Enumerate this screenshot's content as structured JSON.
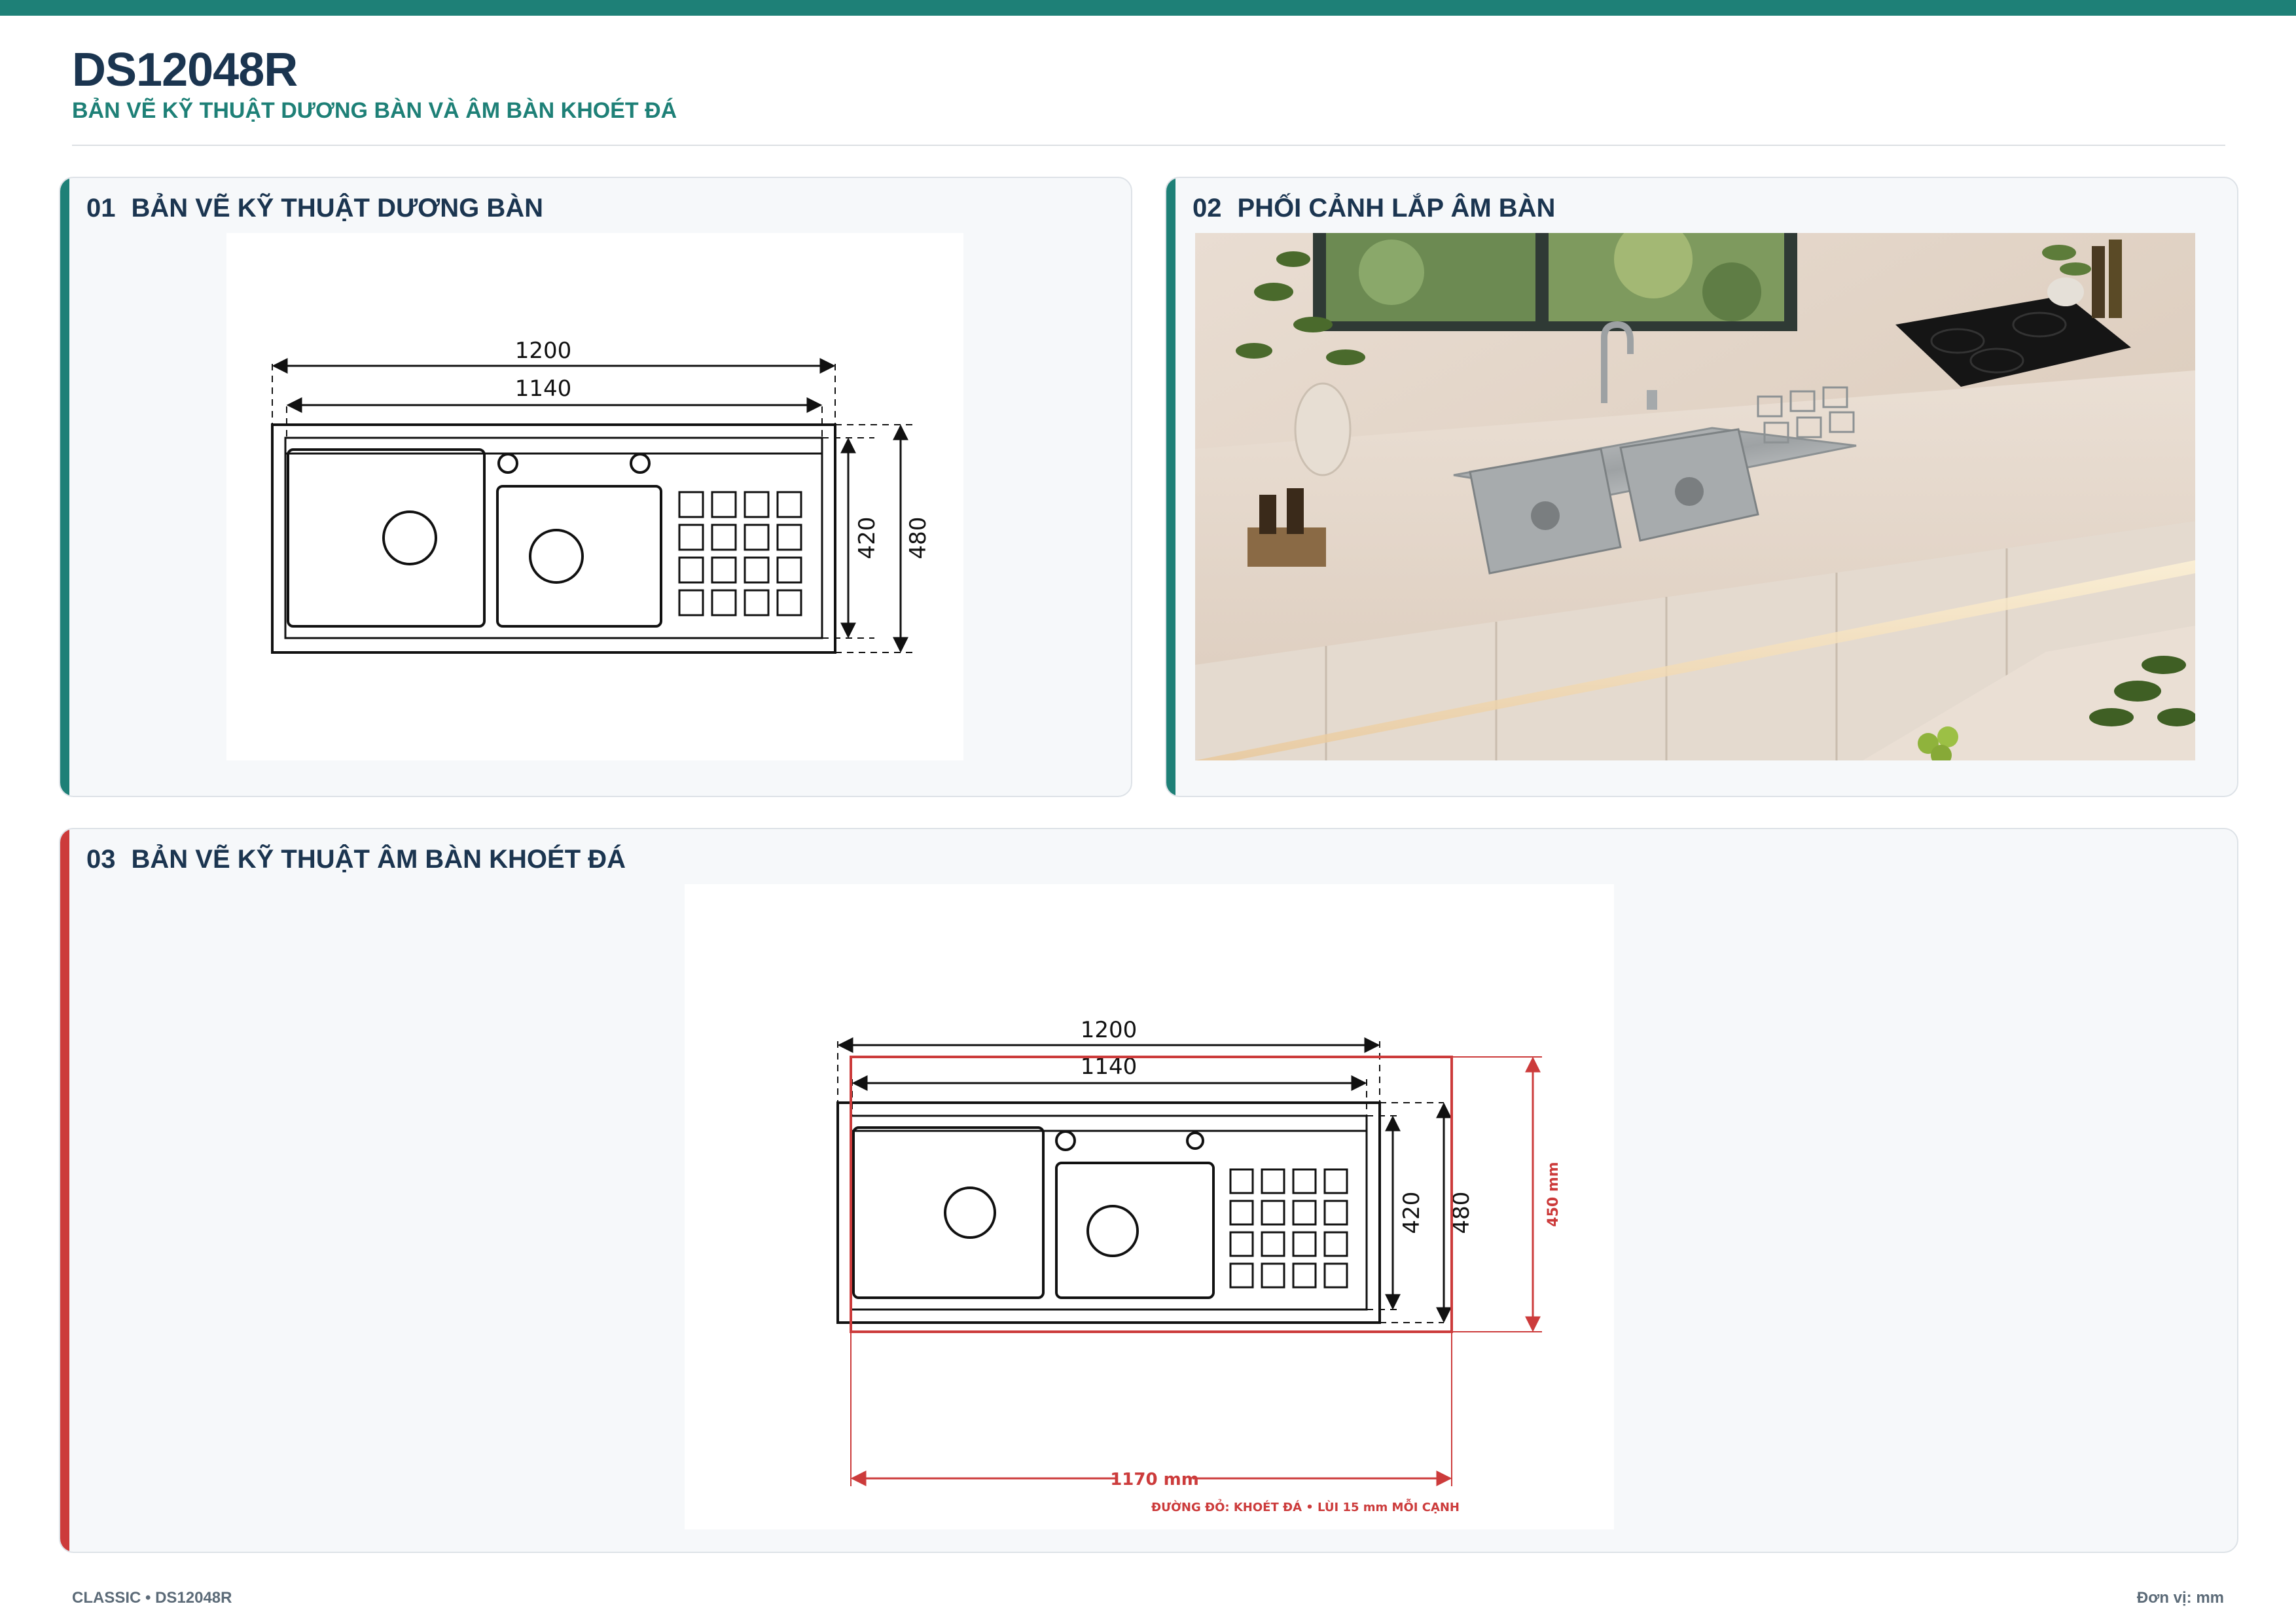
{
  "header": {
    "model": "DS12048R",
    "subtitle": "BẢN VẼ KỸ THUẬT DƯƠNG BÀN VÀ ÂM BÀN KHOÉT ĐÁ"
  },
  "panels": [
    {
      "number": "01",
      "title": "BẢN VẼ KỸ THUẬT DƯƠNG BÀN",
      "accent": "#1e8077"
    },
    {
      "number": "02",
      "title": "PHỐI CẢNH LẮP ÂM BÀN",
      "accent": "#1e8077"
    },
    {
      "number": "03",
      "title": "BẢN VẼ KỸ THUẬT ÂM BÀN KHOÉT ĐÁ",
      "accent": "#cc3b3b"
    }
  ],
  "dimensions": {
    "overall_width": "1200",
    "inner_width": "1140",
    "inner_depth": "420",
    "overall_depth": "480",
    "cutout_width": "1170 mm",
    "cutout_depth": "450 mm",
    "cutout_note": "ĐƯỜNG ĐỎ: KHOÉT ĐÁ • LÙI 15 mm MỖI CẠNH"
  },
  "footer": {
    "left": "CLASSIC • DS12048R",
    "right": "Đơn vị: mm"
  },
  "colors": {
    "brand": "#1e8077",
    "title": "#1b3550",
    "cutout": "#cc3b3b"
  }
}
